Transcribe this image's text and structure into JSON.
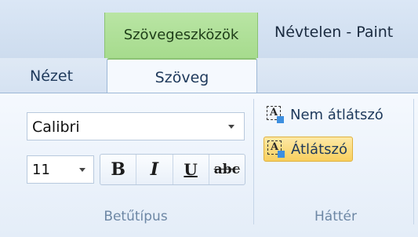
{
  "header": {
    "context_tab": "Szövegeszközök",
    "window_title": "Névtelen - Paint"
  },
  "tabs": [
    {
      "label": "Nézet",
      "active": false
    },
    {
      "label": "Szöveg",
      "active": true
    }
  ],
  "font_group": {
    "font_name": "Calibri",
    "font_size": "11",
    "buttons": [
      {
        "name": "bold",
        "glyph": "B"
      },
      {
        "name": "italic",
        "glyph": "I"
      },
      {
        "name": "underline",
        "glyph": "U"
      },
      {
        "name": "strikethrough",
        "glyph": "abc"
      }
    ],
    "label": "Betűtípus"
  },
  "background_group": {
    "opaque_label": "Nem átlátszó",
    "transparent_label": "Átlátszó",
    "selected": "transparent",
    "icon_letter": "A",
    "label": "Háttér"
  },
  "colors": {
    "context_green": "#a6db8d",
    "selected_highlight": "#f8cf5e",
    "icon_fill": "#3d8fe0"
  }
}
